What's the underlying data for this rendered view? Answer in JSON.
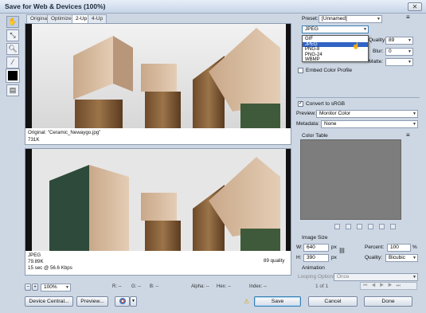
{
  "window": {
    "title": "Save for Web & Devices (100%)",
    "close": "✕"
  },
  "tabs": [
    "Original",
    "Optimized",
    "2-Up",
    "4-Up"
  ],
  "pane_top": {
    "caption1": "Original: \"Ceramic_Newaygo.jpg\"",
    "caption2": "731K"
  },
  "pane_bottom": {
    "format": "JPEG",
    "size": "79.89K",
    "time": "15 sec @ 56.6 Kbps",
    "quality": "89 quality"
  },
  "settings": {
    "preset_label": "Preset:",
    "preset_value": "[Unnamed]",
    "format_value": "JPEG",
    "format_options": [
      "GIF",
      "JPEG",
      "PNG-8",
      "PNG-24",
      "WBMP"
    ],
    "selected_option": "JPEG",
    "quality_label": "Quality:",
    "quality_value": "89",
    "blur_label": "Blur:",
    "blur_value": "0",
    "matte_label": "Matte:",
    "embed_label": "Embed Color Profile",
    "convert_label": "Convert to sRGB",
    "convert_checked": "✓",
    "preview_label": "Preview:",
    "preview_value": "Monitor Color",
    "metadata_label": "Metadata:",
    "metadata_value": "None",
    "colortable_label": "Color Table"
  },
  "image_size": {
    "title": "Image Size",
    "w_label": "W:",
    "w_value": "640",
    "h_label": "H:",
    "h_value": "390",
    "unit": "px",
    "percent_label": "Percent:",
    "percent_value": "100",
    "percent_unit": "%",
    "quality_label": "Quality:",
    "quality_value": "Bicubic"
  },
  "animation": {
    "title": "Animation",
    "looping_label": "Looping Options:",
    "looping_value": "Once",
    "frame_counter": "1 of 1"
  },
  "statusbar": {
    "zoom": "100%",
    "r": "R: --",
    "g": "G: --",
    "b": "B: --",
    "alpha": "Alpha: --",
    "hex": "Hex: --",
    "index": "Index: --",
    "minus": "−",
    "plus": "+"
  },
  "buttons": {
    "device_central": "Device Central...",
    "preview": "Preview...",
    "save": "Save",
    "cancel": "Cancel",
    "done": "Done"
  }
}
